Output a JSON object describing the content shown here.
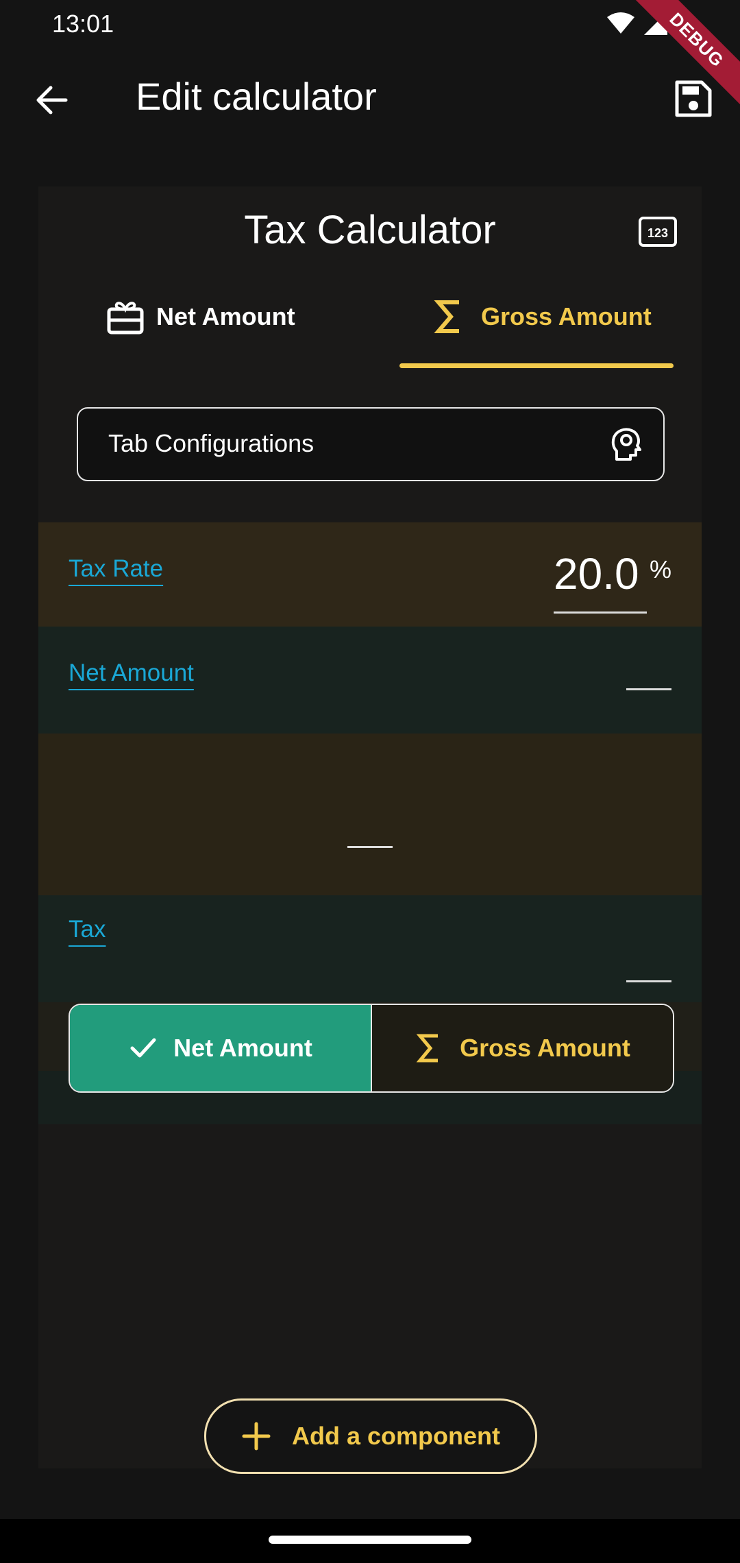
{
  "status_bar": {
    "time": "13:01",
    "debug_label": "DEBUG"
  },
  "app_bar": {
    "title": "Edit calculator",
    "back_icon": "arrow-back-icon",
    "save_icon": "save-icon"
  },
  "calculator": {
    "title": "Tax Calculator",
    "numbers_icon": "123-icon",
    "tabs": [
      {
        "label": "Net Amount",
        "icon": "redeem-icon",
        "selected": false
      },
      {
        "label": "Gross Amount",
        "icon": "sigma-icon",
        "selected": true
      }
    ],
    "tab_config": {
      "label": "Tab Configurations",
      "icon": "psychology-icon"
    },
    "fields": {
      "tax_rate": {
        "label": "Tax Rate",
        "value": "20.0",
        "unit": "%"
      },
      "net_amount": {
        "label": "Net Amount",
        "value": ""
      },
      "gross_amount": {
        "value": ""
      },
      "tax": {
        "label": "Tax",
        "value": ""
      }
    },
    "segmented": [
      {
        "label": "Net Amount",
        "icon": "check-icon",
        "selected": true
      },
      {
        "label": "Gross Amount",
        "icon": "sigma-icon",
        "selected": false
      }
    ]
  },
  "add_component": {
    "label": "Add a component",
    "icon": "plus-icon"
  },
  "colors": {
    "accent_yellow": "#f2c94c",
    "accent_green": "#229c7c",
    "link_blue": "#1aa8d6"
  }
}
